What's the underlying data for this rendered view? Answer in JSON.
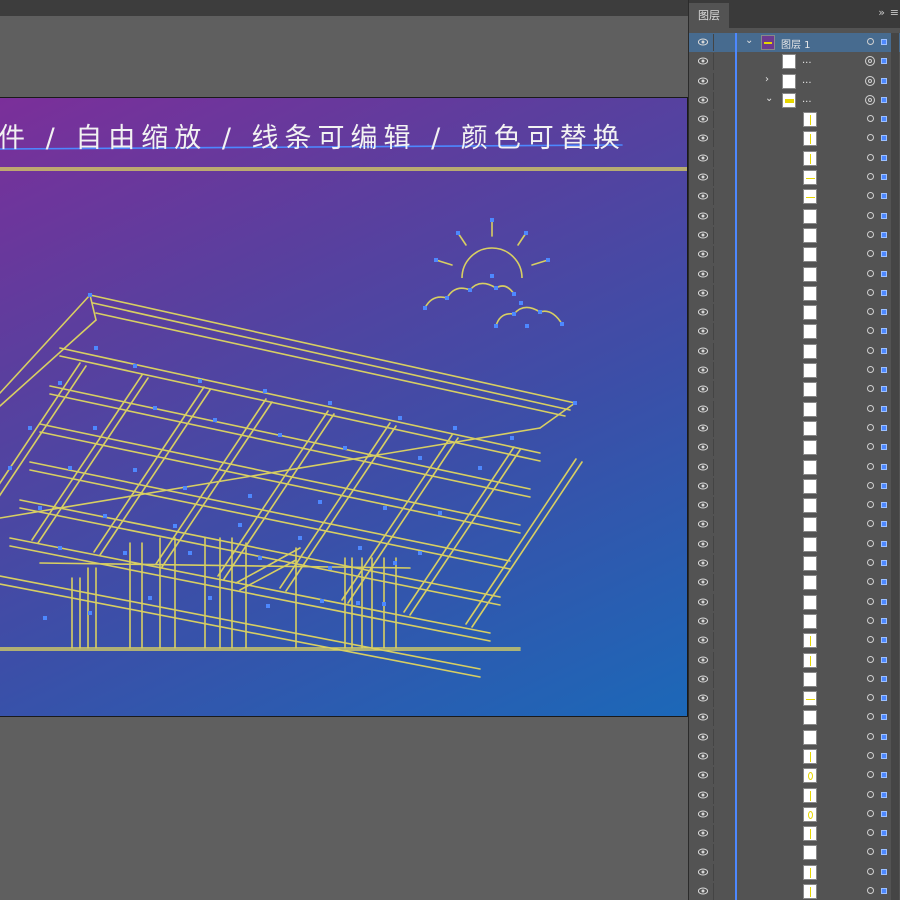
{
  "artboard": {
    "headline": "件 / 自由缩放 / 线条可编辑 / 颜色可替换"
  },
  "colors": {
    "stroke": "#d8cf62",
    "selection": "#4d88ff",
    "canvas_bg": "#5f5f5f",
    "panel_bg": "#535353"
  },
  "panel": {
    "tab_label": "图层",
    "collapse_icon": "»",
    "menu_icon": "≡",
    "rows": [
      {
        "name": "图层 1",
        "level": 0,
        "arrow": "⌄",
        "thumb": "layer",
        "target": "single"
      },
      {
        "name": "...",
        "level": 1,
        "arrow": "",
        "thumb": "blank",
        "target": "double"
      },
      {
        "name": "...",
        "level": 1,
        "arrow": "›",
        "thumb": "blank",
        "target": "double"
      },
      {
        "name": "...",
        "level": 1,
        "arrow": "⌄",
        "thumb": "yellow",
        "target": "double"
      },
      {
        "name": "",
        "level": 2,
        "thumb": "v"
      },
      {
        "name": "",
        "level": 2,
        "thumb": "v"
      },
      {
        "name": "",
        "level": 2,
        "thumb": "v"
      },
      {
        "name": "",
        "level": 2,
        "thumb": "h"
      },
      {
        "name": "",
        "level": 2,
        "thumb": "h"
      },
      {
        "name": "",
        "level": 2,
        "thumb": "blank"
      },
      {
        "name": "",
        "level": 2,
        "thumb": "blank"
      },
      {
        "name": "",
        "level": 2,
        "thumb": "blank"
      },
      {
        "name": "",
        "level": 2,
        "thumb": "blank"
      },
      {
        "name": "",
        "level": 2,
        "thumb": "blank"
      },
      {
        "name": "",
        "level": 2,
        "thumb": "blank"
      },
      {
        "name": "",
        "level": 2,
        "thumb": "blank"
      },
      {
        "name": "",
        "level": 2,
        "thumb": "blank"
      },
      {
        "name": "",
        "level": 2,
        "thumb": "blank"
      },
      {
        "name": "",
        "level": 2,
        "thumb": "blank"
      },
      {
        "name": "",
        "level": 2,
        "thumb": "blank"
      },
      {
        "name": "",
        "level": 2,
        "thumb": "blank"
      },
      {
        "name": "",
        "level": 2,
        "thumb": "blank"
      },
      {
        "name": "",
        "level": 2,
        "thumb": "blank"
      },
      {
        "name": "",
        "level": 2,
        "thumb": "blank"
      },
      {
        "name": "",
        "level": 2,
        "thumb": "blank"
      },
      {
        "name": "",
        "level": 2,
        "thumb": "blank"
      },
      {
        "name": "",
        "level": 2,
        "thumb": "blank"
      },
      {
        "name": "",
        "level": 2,
        "thumb": "blank"
      },
      {
        "name": "",
        "level": 2,
        "thumb": "blank"
      },
      {
        "name": "",
        "level": 2,
        "thumb": "blank"
      },
      {
        "name": "",
        "level": 2,
        "thumb": "blank"
      },
      {
        "name": "",
        "level": 2,
        "thumb": "v"
      },
      {
        "name": "",
        "level": 2,
        "thumb": "v"
      },
      {
        "name": "",
        "level": 2,
        "thumb": "blank"
      },
      {
        "name": "",
        "level": 2,
        "thumb": "h"
      },
      {
        "name": "",
        "level": 2,
        "thumb": "blank"
      },
      {
        "name": "",
        "level": 2,
        "thumb": "blank"
      },
      {
        "name": "",
        "level": 2,
        "thumb": "v"
      },
      {
        "name": "",
        "level": 2,
        "thumb": "o"
      },
      {
        "name": "",
        "level": 2,
        "thumb": "v"
      },
      {
        "name": "",
        "level": 2,
        "thumb": "o"
      },
      {
        "name": "",
        "level": 2,
        "thumb": "v"
      },
      {
        "name": "",
        "level": 2,
        "thumb": "blank"
      },
      {
        "name": "",
        "level": 2,
        "thumb": "v"
      },
      {
        "name": "",
        "level": 2,
        "thumb": "v"
      }
    ]
  }
}
